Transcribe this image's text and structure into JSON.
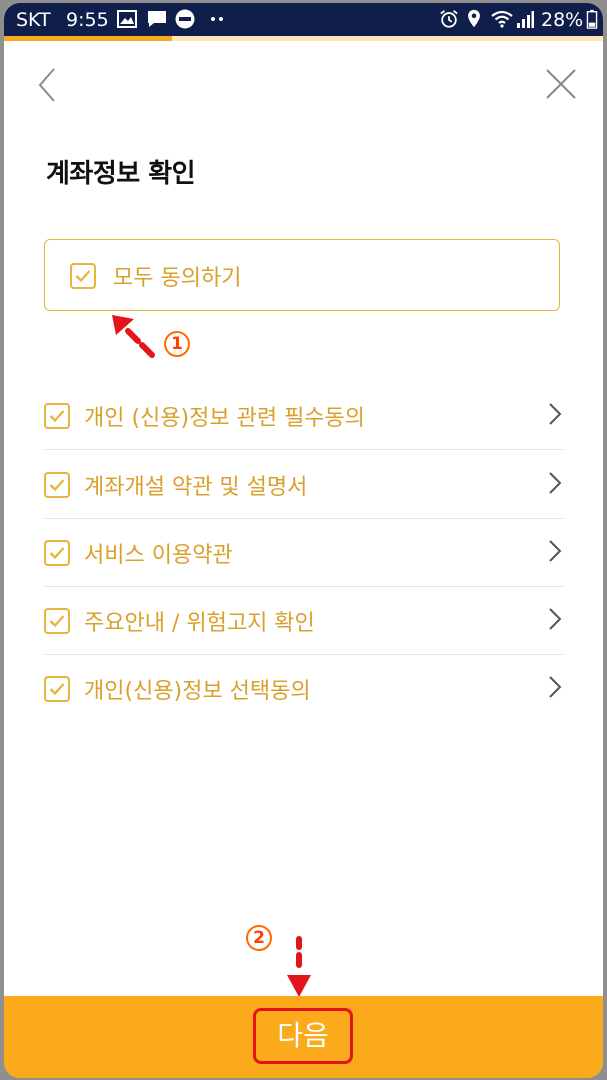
{
  "status_bar": {
    "carrier": "SKT",
    "time": "9:55",
    "battery": "28%",
    "icons": [
      "image-icon",
      "message-icon",
      "band-app-icon",
      "more-dots-icon",
      "alarm-icon",
      "location-icon",
      "wifi-icon",
      "signal-icon",
      "battery-icon"
    ]
  },
  "progress": {
    "value_percent": 28,
    "color": "#f7a81c"
  },
  "nav": {
    "back_icon": "chevron-left-icon",
    "close_icon": "close-icon"
  },
  "page": {
    "title": "계좌정보 확인"
  },
  "agree_all": {
    "label": "모두 동의하기",
    "checked": true
  },
  "terms": [
    {
      "label": "개인 (신용)정보 관련 필수동의",
      "checked": true
    },
    {
      "label": "계좌개설 약관 및 설명서",
      "checked": true
    },
    {
      "label": "서비스 이용약관",
      "checked": true
    },
    {
      "label": "주요안내 / 위험고지 확인",
      "checked": true
    },
    {
      "label": "개인(신용)정보 선택동의",
      "checked": true
    }
  ],
  "footer": {
    "next_label": "다음"
  },
  "annotations": [
    {
      "number": "1"
    },
    {
      "number": "2"
    }
  ],
  "colors": {
    "accent": "#fbaa1b",
    "check": "#e5b53d",
    "label": "#d9a02c",
    "status_bar": "#0f1e4a",
    "highlight_border": "#e4141b"
  }
}
